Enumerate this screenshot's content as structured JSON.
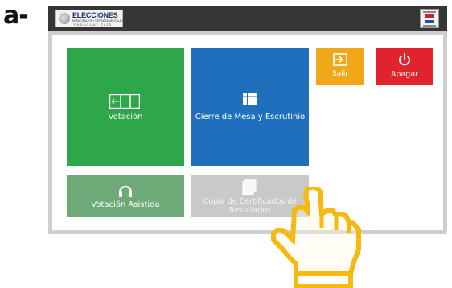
{
  "step_label": "a-",
  "topbar": {
    "logo": {
      "title": "ELECCIONES",
      "subtitle": "MUNICIPALES Y DEPARTAMENTALES",
      "country_line": "PARAGUAY 2023"
    },
    "emblem_icon": "tsje-emblem-icon"
  },
  "tiles": {
    "votacion": {
      "label": "Votación",
      "icon": "ballot-box-icon",
      "color": "#2ea64a"
    },
    "cierre": {
      "label": "Cierre de Mesa y Escrutinio",
      "icon": "grid-list-icon",
      "color": "#1f6fbd"
    },
    "salir": {
      "label": "Salir",
      "icon": "exit-icon",
      "color": "#f0a81a"
    },
    "apagar": {
      "label": "Apagar",
      "icon": "power-icon",
      "color": "#e0232d"
    },
    "asistida": {
      "label": "Votación Asistida",
      "icon": "headphones-icon",
      "color": "#6daa78"
    },
    "copia": {
      "label_line1": "Copia de Certificados de",
      "label_line2": "Resultados",
      "icon": "document-copy-icon",
      "color": "#c9c9c9"
    }
  },
  "overlay": {
    "icon": "pointing-hand-icon",
    "color": "#f6b90f"
  }
}
